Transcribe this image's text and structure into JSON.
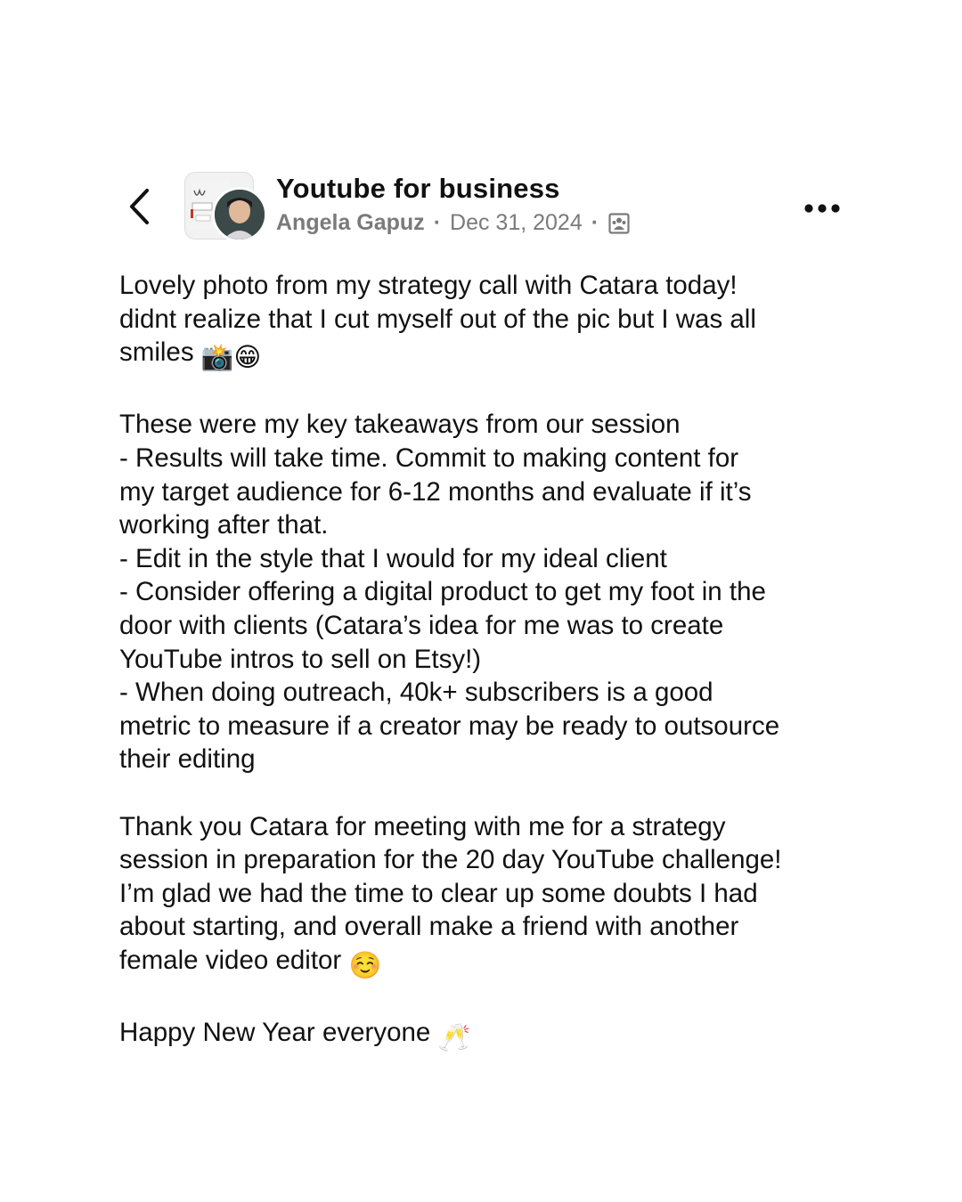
{
  "header": {
    "group_name": "Youtube for business",
    "author": "Angela Gapuz",
    "separator": "·",
    "date": "Dec 31, 2024",
    "privacy_icon": "members-only-group-icon",
    "back_icon": "chevron-left-icon",
    "more_icon": "more-horizontal-icon"
  },
  "post": {
    "lines": [
      "Lovely photo from my strategy call with Catara today!",
      "didnt realize that I cut myself out of the pic but I was all",
      "smiles",
      "These were my key takeaways from our session",
      "- Results will take time. Commit to making content for",
      "my target audience for 6-12 months and evaluate if it’s",
      "working after that.",
      "- Edit in the style that I would for my ideal client",
      "- Consider offering a digital product to get my foot in the",
      "door with clients (Catara’s idea for me was to create",
      "YouTube intros to sell on Etsy!)",
      "- When doing outreach, 40k+ subscribers is a good",
      "metric to measure if a creator may be ready to outsource",
      "their editing",
      "Thank you Catara for meeting with me for a strategy",
      "session in preparation for the 20 day YouTube challenge!",
      "I’m glad we had the time to clear up some doubts I had",
      "about starting, and overall make a friend with another",
      "female video editor",
      "Happy New Year everyone"
    ],
    "emojis": {
      "smiles_1": "📸",
      "smiles_2": "😁",
      "editor": "☺️",
      "new_year": "🥂"
    }
  }
}
